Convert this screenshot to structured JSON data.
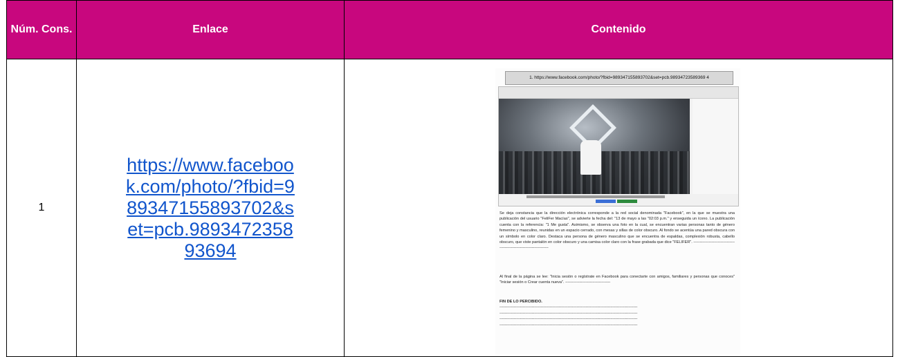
{
  "table": {
    "headers": {
      "num": "Núm. Cons.",
      "link": "Enlace",
      "content": "Contenido"
    },
    "rows": [
      {
        "num": "1",
        "link": "https://www.facebook.com/photo/?fbid=989347155893702&set=pcb.989347235893694"
      }
    ]
  },
  "scan": {
    "url_label": "1. https://www.facebook.com/photo/?fbid=989347155893702&set=pcb.98934723589369 4",
    "paragraph1": "Se deja constancia que la dirección electrónica corresponde a la red social denominada \"Facebook\", en la que se muestra una publicación del usuario \"FeliFer Macías\", se advierte la fecha del: \"13 de mayo a las \"02:03 p.m.\" y enseguida un ícono. La publicación cuenta con la referencia: \"1 Me gusta\". Asimismo, se observa una foto en la cual, se encuentran varias personas tanto de género femenino y masculino, reunidas en un espacio cerrado, con mesas y sillas de color obscuro. Al fondo se acentúa una pared obscura con un símbolo en color claro. Destaca una persona de género masculino que se encuentra de espaldas, complexión robusta, cabello obscuro, que viste pantalón en color obscuro y una camisa color claro con la frase grabada que dice \"FELIFER\". ----------------------------------------------------------------------",
    "paragraph2": "Al final de la página se lee: \"Inicia sesión o regístrate en Facebook para conectarte con amigos, familiares y personas que conoces\" \"Iniciar sesión o Crear cuenta nueva\". -----------------------------------",
    "end_label": "FIN DE LO PERCIBIDO.",
    "dashes": "-----------------------------------------------------------------------------------------------------------"
  },
  "colors": {
    "header_bg": "#c8077e",
    "link": "#1155cc"
  }
}
